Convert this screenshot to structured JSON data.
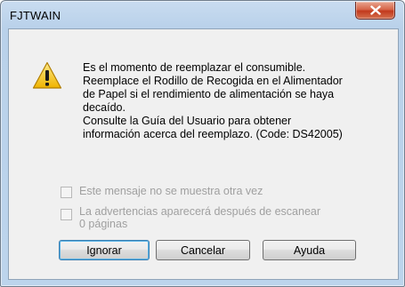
{
  "window": {
    "title": "FJTWAIN"
  },
  "dialog": {
    "message": "Es el momento de reemplazar el consumible.\nReemplace el Rodillo de Recogida en el Alimentador\nde Papel si el rendimiento de alimentación se haya\ndecaído.\n Consulte la Guía del Usuario para obtener\ninformación acerca del reemplazo.  (Code: DS42005)",
    "icon": "warning-icon",
    "checkboxes": [
      {
        "label": "Este mensaje no se muestra otra vez",
        "checked": false,
        "enabled": false
      },
      {
        "label": "La advertencias aparecerá después de escanear\n0 páginas",
        "checked": false,
        "enabled": false
      }
    ],
    "buttons": {
      "ignore": "Ignorar",
      "cancel": "Cancelar",
      "help": "Ayuda"
    }
  },
  "colors": {
    "frame": "#b9d1ea",
    "client": "#f0f0f0",
    "close_button": "#c23a1d",
    "disabled_text": "#a0a0a0",
    "warning_yellow": "#f5c211"
  }
}
